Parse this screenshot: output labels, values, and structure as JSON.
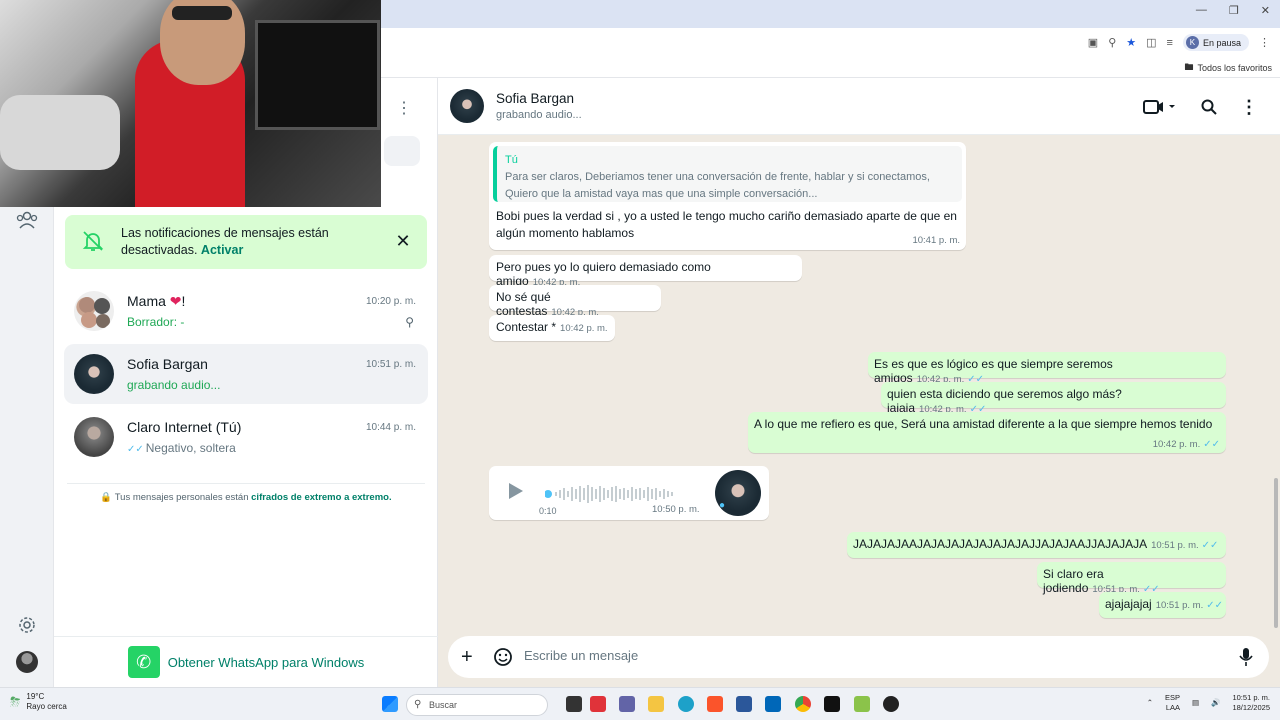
{
  "browser": {
    "paused_label": "En pausa",
    "profile_initial": "K",
    "bookmarks_label": "Todos los favoritos"
  },
  "notification": {
    "text": "Las notificaciones de mensajes están desactivadas.",
    "action": "Activar"
  },
  "chats": [
    {
      "name": "Mama",
      "suffix": "!",
      "time": "10:20 p. m.",
      "sub": "Borrador: -"
    },
    {
      "name": "Sofia Bargan",
      "time": "10:51 p. m.",
      "sub": "grabando audio..."
    },
    {
      "name": "Claro Internet (Tú)",
      "time": "10:44 p. m.",
      "sub": "Negativo, soltera"
    }
  ],
  "encryption": {
    "text": "Tus mensajes personales están",
    "link": "cifrados de extremo a extremo."
  },
  "get_whatsapp": "Obtener WhatsApp para Windows",
  "conversation": {
    "name": "Sofia Bargan",
    "status": "grabando audio...",
    "quote": {
      "author": "Tú",
      "line1": "Para ser claros, Deberiamos tener una conversación de frente, hablar y si conectamos,",
      "line2": "Quiero que la amistad vaya mas que una simple conversación..."
    },
    "messages": [
      {
        "text": "Bobi pues la verdad si , yo a usted le tengo  mucho cariño demasiado  aparte de que en algún momento hablamos",
        "time": "10:41 p. m."
      },
      {
        "text": "Pero pues yo lo quiero demasiado como amigo",
        "time": "10:42 p. m."
      },
      {
        "text": "No sé qué contestas",
        "time": "10:42 p. m."
      },
      {
        "text": "Contestar *",
        "time": "10:42 p. m."
      },
      {
        "text": "Es es que es lógico es que siempre seremos amigos",
        "time": "10:42 p. m."
      },
      {
        "text": "quien esta diciendo que seremos algo más? jajaja",
        "time": "10:42 p. m."
      },
      {
        "text": "A lo que me refiero es que, Será una amistad diferente a la que siempre hemos tenido",
        "time": "10:42 p. m."
      },
      {
        "duration": "0:10",
        "time": "10:50 p. m."
      },
      {
        "text": "JAJAJAJAAJAJAJAJAJAJAJAJAJJAJAJAAJJAJAJAJA",
        "time": "10:51 p. m."
      },
      {
        "text": "Si claro era jodiendo",
        "time": "10:51 p. m."
      },
      {
        "text": "ajajajajaj",
        "time": "10:51 p. m."
      }
    ],
    "composer_placeholder": "Escribe un mensaje"
  },
  "taskbar": {
    "weather_temp": "19°C",
    "weather_desc": "Rayo cerca",
    "search_placeholder": "Buscar",
    "lang1": "ESP",
    "lang2": "LAA",
    "time": "10:51 p. m.",
    "date": "18/12/2025"
  },
  "colors": {
    "accent": "#25d366",
    "outgoing_bubble": "#d9fdd3",
    "chat_bg": "#efeae2"
  }
}
